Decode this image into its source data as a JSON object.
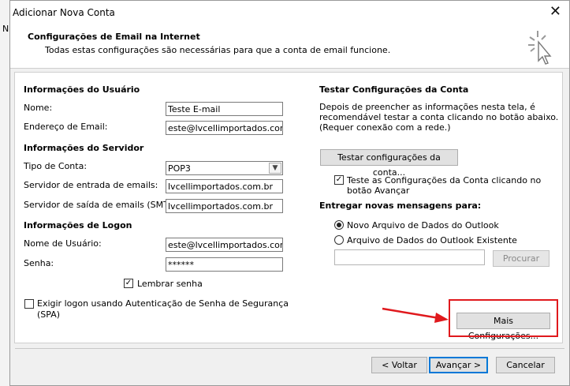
{
  "window": {
    "title": "Adicionar Nova Conta",
    "close_glyph": "✕"
  },
  "background": {
    "glyph": "N"
  },
  "header": {
    "title": "Configurações de Email na Internet",
    "subtitle": "Todas estas configurações são necessárias para que a conta de email funcione.",
    "icon": "cursor-click-icon"
  },
  "user_info": {
    "heading": "Informações do Usuário",
    "name_label": "Nome:",
    "name_value": "Teste E-mail",
    "email_label": "Endereço de Email:",
    "email_value": "este@lvcellimportados.com.br"
  },
  "server_info": {
    "heading": "Informações do Servidor",
    "type_label": "Tipo de Conta:",
    "type_value": "POP3",
    "incoming_label": "Servidor de entrada de emails:",
    "incoming_value": "lvcellimportados.com.br",
    "outgoing_label": "Servidor de saída de emails (SMTP):",
    "outgoing_value": "lvcellimportados.com.br"
  },
  "logon_info": {
    "heading": "Informações de Logon",
    "username_label": "Nome de Usuário:",
    "username_value": "este@lvcellimportados.com.br",
    "password_label": "Senha:",
    "password_value": "******",
    "remember_label": "Lembrar senha",
    "remember_checked": true,
    "spa_label_line1": "Exigir logon usando Autenticação de Senha de Segurança",
    "spa_label_line2": "(SPA)",
    "spa_checked": false
  },
  "test_settings": {
    "heading": "Testar Configurações da Conta",
    "desc_line1": "Depois de preencher as informações nesta tela, é",
    "desc_line2": "recomendável testar a conta clicando no botão abaixo.",
    "desc_line3": "(Requer conexão com a rede.)",
    "test_button": "Testar configurações da conta...",
    "auto_test_line1": "Teste as Configurações da Conta clicando no",
    "auto_test_line2": "botão Avançar",
    "auto_test_checked": true
  },
  "delivery": {
    "heading": "Entregar novas mensagens para:",
    "option_new": "Novo Arquivo de Dados do Outlook",
    "option_existing": "Arquivo de Dados do Outlook Existente",
    "selected": "new",
    "browse_button": "Procurar"
  },
  "more_settings_button": "Mais Configurações...",
  "footer": {
    "back": "< Voltar",
    "next": "Avançar >",
    "cancel": "Cancelar"
  },
  "colors": {
    "annotation": "#e0191d",
    "default_button_border": "#0078d7"
  }
}
